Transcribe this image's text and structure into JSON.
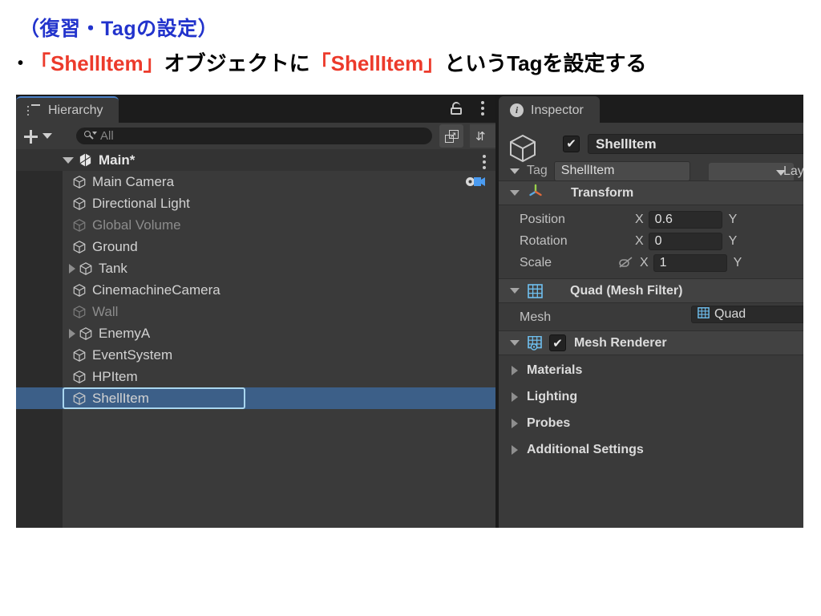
{
  "slide": {
    "heading": "（復習・Tagの設定）",
    "bullet_mark": "•",
    "bullet_parts": {
      "p1": "「ShellItem」",
      "p2": "オブジェクトに",
      "p3": "「ShellItem」",
      "p4": "というTagを設定する"
    },
    "colors": {
      "heading": "#2233cc",
      "highlight": "#ec3a2b",
      "body": "#000000"
    }
  },
  "hierarchy": {
    "tab_label": "Hierarchy",
    "tab_icon": "hierarchy-list-icon",
    "lock_icon": "lock-open-icon",
    "menu_icon": "kebab-menu-icon",
    "add_button_label": "+",
    "search": {
      "placeholder": "All",
      "value": "",
      "icon": "search-icon"
    },
    "tool_buttons": [
      {
        "name": "pick-visibility-icon"
      },
      {
        "name": "sort-icon"
      }
    ],
    "items": [
      {
        "label": "Main*",
        "depth": 0,
        "expander": "down",
        "icon": "unity-logo-icon",
        "dim": false,
        "selected": false,
        "root": true,
        "kebab": true
      },
      {
        "label": "Main Camera",
        "depth": 1,
        "expander": "none",
        "icon": "gameobject-cube-icon",
        "dim": false,
        "selected": false,
        "camera_badge": true
      },
      {
        "label": "Directional Light",
        "depth": 1,
        "expander": "none",
        "icon": "gameobject-cube-icon",
        "dim": false,
        "selected": false
      },
      {
        "label": "Global Volume",
        "depth": 1,
        "expander": "none",
        "icon": "gameobject-cube-icon",
        "dim": true,
        "selected": false
      },
      {
        "label": "Ground",
        "depth": 1,
        "expander": "none",
        "icon": "gameobject-cube-icon",
        "dim": false,
        "selected": false
      },
      {
        "label": "Tank",
        "depth": 1,
        "expander": "right",
        "icon": "gameobject-cube-icon",
        "dim": false,
        "selected": false
      },
      {
        "label": "CinemachineCamera",
        "depth": 1,
        "expander": "none",
        "icon": "gameobject-cube-icon",
        "dim": false,
        "selected": false
      },
      {
        "label": "Wall",
        "depth": 1,
        "expander": "none",
        "icon": "gameobject-cube-icon",
        "dim": true,
        "selected": false
      },
      {
        "label": "EnemyA",
        "depth": 1,
        "expander": "right",
        "icon": "gameobject-cube-icon",
        "dim": false,
        "selected": false
      },
      {
        "label": "EventSystem",
        "depth": 1,
        "expander": "none",
        "icon": "gameobject-cube-icon",
        "dim": false,
        "selected": false
      },
      {
        "label": "HPItem",
        "depth": 1,
        "expander": "none",
        "icon": "gameobject-cube-icon",
        "dim": false,
        "selected": false
      },
      {
        "label": "ShellItem",
        "depth": 1,
        "expander": "none",
        "icon": "gameobject-cube-icon",
        "dim": false,
        "selected": true
      }
    ]
  },
  "inspector": {
    "tab_label": "Inspector",
    "tab_icon": "info-icon",
    "object": {
      "icon": "gameobject-cube-icon",
      "enabled": true,
      "name": "ShellItem",
      "tag_label": "Tag",
      "tag_value": "ShellItem",
      "layer_label": "Lay",
      "layer_value": ""
    },
    "components": [
      {
        "name": "Transform",
        "icon": "transform-axis-icon",
        "expanded": true,
        "rows": [
          {
            "label": "Position",
            "axis": "X",
            "value": "0.6",
            "link_icon": null
          },
          {
            "label": "Rotation",
            "axis": "X",
            "value": "0",
            "link_icon": null
          },
          {
            "label": "Scale",
            "axis": "X",
            "value": "1",
            "link_icon": "link-off-icon"
          }
        ]
      },
      {
        "name": "Quad (Mesh Filter)",
        "icon": "mesh-filter-icon",
        "expanded": true,
        "mesh_label": "Mesh",
        "mesh_value": "Quad",
        "mesh_value_icon": "mesh-icon"
      },
      {
        "name": "Mesh Renderer",
        "icon": "mesh-renderer-icon",
        "expanded": true,
        "enabled": true,
        "foldouts": [
          "Materials",
          "Lighting",
          "Probes",
          "Additional Settings"
        ]
      }
    ]
  }
}
